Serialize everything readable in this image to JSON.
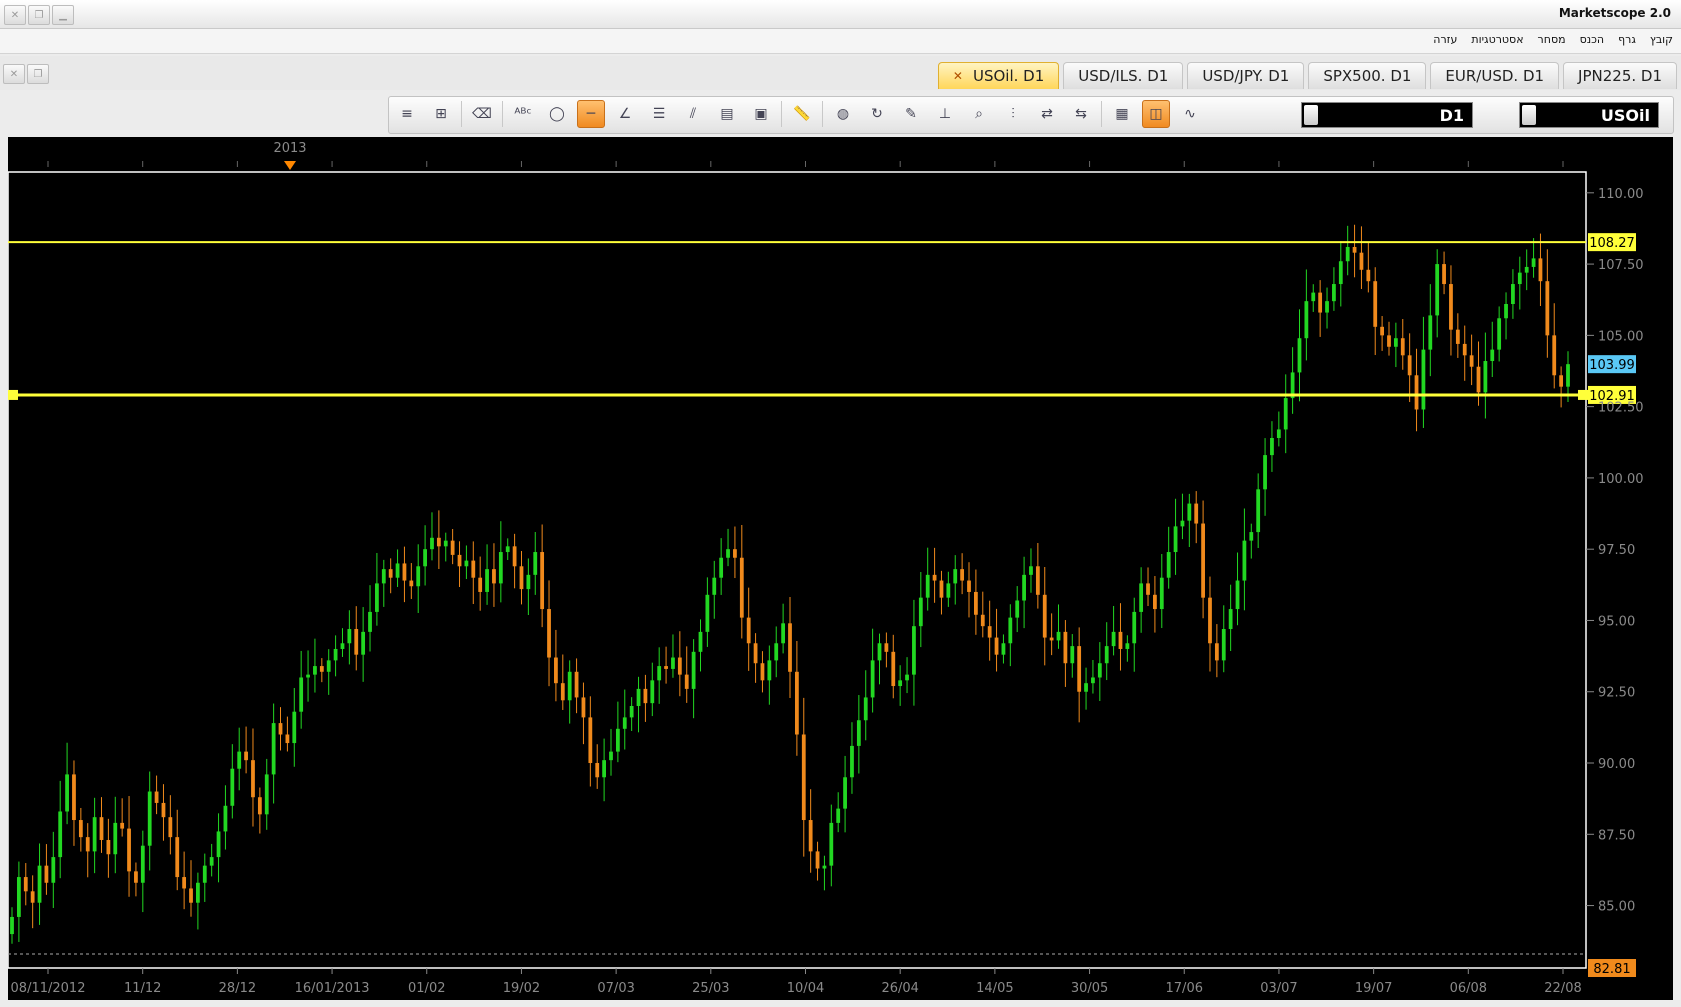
{
  "app": {
    "title": "Marketscope 2.0"
  },
  "menu": [
    "קובץ",
    "גרף",
    "הכנס",
    "מסחר",
    "אסטרטגיות",
    "עזרה"
  ],
  "tabs": [
    {
      "label": "USOil. D1",
      "active": true
    },
    {
      "label": "USD/ILS. D1",
      "active": false
    },
    {
      "label": "USD/JPY. D1",
      "active": false
    },
    {
      "label": "SPX500. D1",
      "active": false
    },
    {
      "label": "EUR/USD. D1",
      "active": false
    },
    {
      "label": "JPN225. D1",
      "active": false
    }
  ],
  "toolbar": {
    "timeframe": "D1",
    "instrument": "USOil",
    "icons": [
      "collapse-icon",
      "hierarchy-icon",
      "eraser-icon",
      "text-tool-icon",
      "ellipse-icon",
      "horizontal-line-icon",
      "trendline-icon",
      "channel-icon",
      "fork-icon",
      "chart-window-icon",
      "image-icon",
      "ruler-icon",
      "globe-icon",
      "zoom-rotate-icon",
      "edit-chart-icon",
      "vertical-range-icon",
      "magnify-icon",
      "candles-icon",
      "compare-icon",
      "compare-alt-icon",
      "layout-icon",
      "panel-icon",
      "indicator-icon"
    ]
  },
  "colors": {
    "up": "#22d822",
    "down": "#f08a1c",
    "level_line": "#ffff3a",
    "current_price": "#5ac8f5",
    "bg": "#000000",
    "axis": "#ffffff"
  },
  "chart_data": {
    "type": "candlestick",
    "instrument": "USOil",
    "timeframe": "D1",
    "year_marker": "2013",
    "yaxis": {
      "min": 82.81,
      "max": 110.0,
      "ticks": [
        "110.00",
        "107.50",
        "105.00",
        "102.50",
        "100.00",
        "97.50",
        "95.00",
        "92.50",
        "90.00",
        "87.50",
        "85.00"
      ]
    },
    "xaxis_labels": [
      "08/11/2012",
      "11/12",
      "28/12",
      "16/01/2013",
      "01/02",
      "19/02",
      "07/03",
      "25/03",
      "10/04",
      "26/04",
      "14/05",
      "30/05",
      "17/06",
      "03/07",
      "19/07",
      "06/08",
      "22/08"
    ],
    "markers": {
      "upper_line": "108.27",
      "lower_line": "102.91",
      "current": "103.99",
      "bottom": "82.81"
    },
    "closes": [
      84.6,
      86.0,
      85.5,
      85.1,
      86.4,
      85.8,
      86.7,
      88.3,
      89.6,
      88.0,
      87.4,
      86.9,
      88.1,
      87.3,
      86.8,
      87.9,
      87.7,
      86.2,
      85.8,
      87.1,
      89.0,
      88.6,
      88.1,
      87.4,
      86.0,
      85.6,
      85.1,
      85.8,
      86.4,
      86.7,
      87.6,
      88.5,
      89.8,
      90.4,
      90.1,
      88.8,
      88.2,
      89.6,
      91.4,
      91.0,
      90.7,
      91.8,
      93.0,
      93.1,
      93.4,
      93.2,
      93.6,
      94.0,
      94.2,
      94.7,
      93.8,
      94.6,
      95.3,
      96.3,
      96.8,
      96.5,
      97.0,
      96.4,
      96.2,
      96.9,
      97.5,
      97.9,
      97.6,
      97.8,
      97.3,
      96.9,
      97.1,
      96.5,
      96.0,
      96.8,
      96.3,
      97.4,
      97.6,
      96.9,
      96.1,
      96.6,
      97.4,
      95.4,
      93.7,
      92.8,
      92.2,
      93.2,
      92.3,
      91.6,
      90.0,
      89.5,
      90.1,
      90.4,
      91.2,
      91.6,
      92.0,
      92.6,
      92.1,
      92.9,
      93.4,
      93.3,
      93.7,
      93.1,
      92.6,
      93.9,
      94.6,
      95.9,
      96.5,
      97.2,
      97.5,
      97.2,
      95.1,
      94.2,
      93.5,
      92.9,
      93.6,
      94.2,
      94.9,
      93.2,
      91.0,
      88.0,
      86.9,
      86.3,
      86.4,
      87.9,
      88.4,
      89.5,
      90.6,
      91.5,
      92.3,
      93.6,
      94.2,
      93.9,
      92.7,
      92.9,
      93.1,
      94.8,
      95.8,
      96.6,
      96.4,
      95.8,
      96.3,
      96.8,
      96.4,
      96.0,
      95.2,
      94.8,
      94.4,
      93.8,
      94.2,
      95.1,
      95.7,
      96.6,
      96.9,
      95.9,
      94.4,
      94.3,
      94.6,
      93.5,
      94.1,
      92.5,
      92.8,
      93.0,
      93.5,
      94.1,
      94.6,
      94.0,
      94.2,
      95.3,
      96.3,
      95.9,
      95.4,
      96.5,
      97.4,
      98.3,
      98.5,
      99.1,
      98.4,
      95.8,
      94.2,
      93.6,
      94.7,
      95.4,
      96.4,
      97.8,
      98.1,
      99.6,
      100.8,
      101.4,
      101.7,
      102.8,
      103.7,
      104.9,
      106.2,
      106.5,
      105.8,
      106.2,
      106.8,
      107.6,
      108.1,
      107.9,
      107.3,
      106.9,
      105.3,
      105.0,
      104.6,
      104.9,
      104.3,
      103.6,
      102.4,
      104.5,
      105.7,
      107.5,
      106.8,
      105.2,
      104.7,
      104.3,
      103.9,
      103.0,
      104.1,
      104.5,
      105.6,
      106.1,
      106.8,
      107.2,
      107.4,
      107.7,
      106.9,
      105.0,
      103.6,
      103.2,
      103.99
    ]
  }
}
